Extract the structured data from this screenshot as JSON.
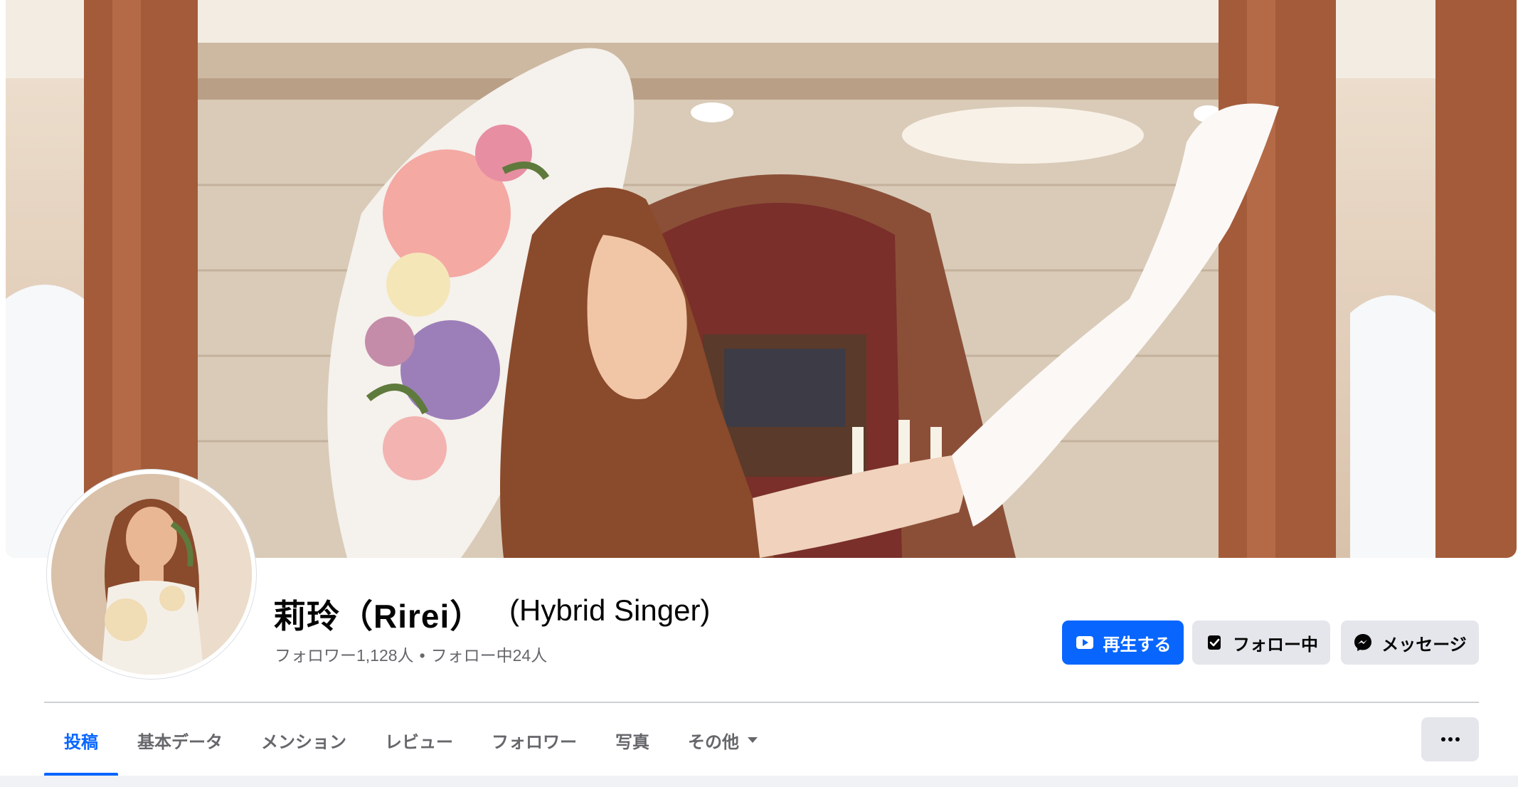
{
  "profile": {
    "name": "莉玲（Rirei）",
    "alternate_name": "(Hybrid Singer)",
    "followers": "フォロワー1,128人",
    "separator": "•",
    "following": "フォロー中24人"
  },
  "actions": {
    "play_label": "再生する",
    "following_label": "フォロー中",
    "message_label": "メッセージ"
  },
  "tabs": [
    {
      "label": "投稿",
      "active": true
    },
    {
      "label": "基本データ"
    },
    {
      "label": "メンション"
    },
    {
      "label": "レビュー"
    },
    {
      "label": "フォロワー"
    },
    {
      "label": "写真"
    },
    {
      "label": "その他"
    }
  ],
  "colors": {
    "accent": "#0866ff",
    "secondary_button": "#e4e6eb",
    "muted_text": "#65676b"
  },
  "icons": {
    "play": "video-play-icon",
    "follow": "following-check-icon",
    "message": "messenger-icon",
    "more": "more-dots-icon",
    "dropdown": "caret-down-icon"
  }
}
